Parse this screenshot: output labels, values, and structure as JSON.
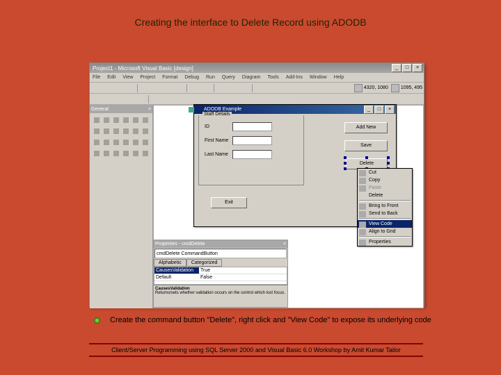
{
  "slide": {
    "title": "Creating the interface to Delete Record using ADODB",
    "caption": "Create the command button \"Delete\", right click and \"View Code\" to expose its underlying code",
    "footer": "Client/Server Programming using SQL Server 2000 and Visual Basic 6.0 Workshop by Amit Kumar Tailor"
  },
  "ide": {
    "title": "Project1 - Microsoft Visual Basic [design]",
    "menu": [
      "File",
      "Edit",
      "View",
      "Project",
      "Format",
      "Debug",
      "Run",
      "Query",
      "Diagram",
      "Tools",
      "Add-Ins",
      "Window",
      "Help"
    ],
    "coords1": "4320, 1080",
    "coords2": "1095, 495",
    "toolbox_title": "General"
  },
  "designer": {
    "form_title": "ADODB Example",
    "groupbox": "Staff Details",
    "fields": {
      "id": "ID",
      "first": "First Name",
      "last": "Last Name"
    },
    "buttons": {
      "addnew": "Add New",
      "save": "Save",
      "delete": "Delete",
      "exit": "Exit"
    }
  },
  "context_menu": {
    "cut": "Cut",
    "copy": "Copy",
    "paste": "Paste",
    "delete": "Delete",
    "bring_front": "Bring to Front",
    "send_back": "Send to Back",
    "view_code": "View Code",
    "align_grid": "Align to Grid",
    "properties": "Properties"
  },
  "props": {
    "panel_title": "Properties - cmdDelete",
    "combo": "cmdDelete   CommandButton",
    "tab1": "Alphabetic",
    "tab2": "Categorized",
    "rows": [
      {
        "k": "CausesValidation",
        "v": "True"
      },
      {
        "k": "Default",
        "v": "False"
      }
    ],
    "desc_title": "CausesValidation",
    "desc_body": "Returns/sets whether validation occurs on the control which lost focus."
  }
}
